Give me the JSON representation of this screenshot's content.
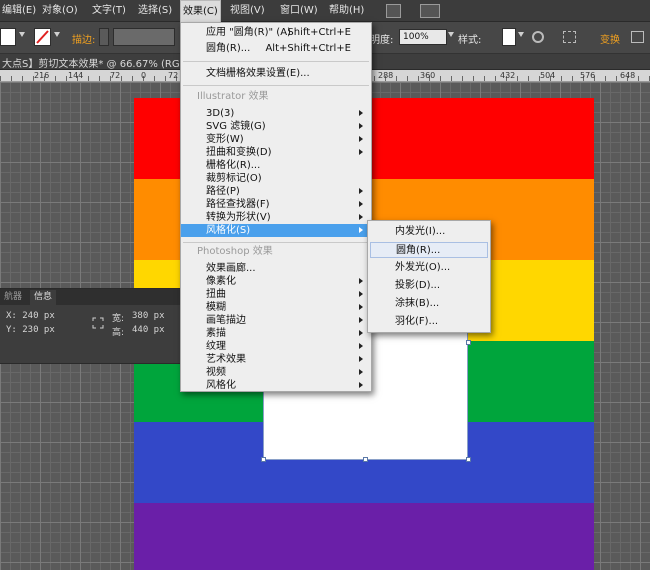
{
  "menubar": {
    "items": [
      {
        "label": "编辑(E)"
      },
      {
        "label": "对象(O)"
      },
      {
        "label": "文字(T)"
      },
      {
        "label": "选择(S)"
      },
      {
        "label": "效果(C)"
      },
      {
        "label": "视图(V)"
      },
      {
        "label": "窗口(W)"
      },
      {
        "label": "帮助(H)"
      }
    ],
    "active_index": 4
  },
  "control_bar": {
    "stroke_label": "描边:",
    "opacity_label": "明度:",
    "opacity_value": "100%",
    "style_label": "样式:",
    "transform_label": "变换",
    "accent_color": "#f0a020"
  },
  "document_tab": {
    "title": "大点S】剪切文本效果* @ 66.67% (RGB"
  },
  "ruler": {
    "labels": [
      "216",
      "144",
      "72",
      "0",
      "72",
      "144",
      "216",
      "288",
      "360",
      "432",
      "504",
      "576",
      "648"
    ]
  },
  "artboard": {
    "stripe_colors": [
      "#ff0000",
      "#ff8c00",
      "#ffd700",
      "#00a53c",
      "#3348c8",
      "#6a1fa8"
    ]
  },
  "info_panel": {
    "tabs": [
      "航器",
      "信息"
    ],
    "active_tab": 1,
    "x": "X: 240 px",
    "y": "Y: 230 px",
    "w_label": "宽:",
    "w_value": "380 px",
    "h_label": "高:",
    "h_value": "440 px"
  },
  "effect_menu": {
    "apply_last": {
      "label": "应用 \"圆角(R)\" (A)",
      "shortcut": "Shift+Ctrl+E"
    },
    "last_effect": {
      "label": "圆角(R)...",
      "shortcut": "Alt+Shift+Ctrl+E"
    },
    "raster_settings": "文档栅格效果设置(E)...",
    "illustrator_section": "Illustrator 效果",
    "illustrator_items": [
      {
        "label": "3D(3)",
        "sub": true
      },
      {
        "label": "SVG 滤镜(G)",
        "sub": true
      },
      {
        "label": "变形(W)",
        "sub": true
      },
      {
        "label": "扭曲和变换(D)",
        "sub": true
      },
      {
        "label": "栅格化(R)...",
        "sub": false
      },
      {
        "label": "裁剪标记(O)",
        "sub": false
      },
      {
        "label": "路径(P)",
        "sub": true
      },
      {
        "label": "路径查找器(F)",
        "sub": true
      },
      {
        "label": "转换为形状(V)",
        "sub": true
      },
      {
        "label": "风格化(S)",
        "sub": true
      }
    ],
    "highlighted_index": 9,
    "photoshop_section": "Photoshop 效果",
    "photoshop_items": [
      {
        "label": "效果画廊...",
        "sub": false
      },
      {
        "label": "像素化",
        "sub": true
      },
      {
        "label": "扭曲",
        "sub": true
      },
      {
        "label": "模糊",
        "sub": true
      },
      {
        "label": "画笔描边",
        "sub": true
      },
      {
        "label": "素描",
        "sub": true
      },
      {
        "label": "纹理",
        "sub": true
      },
      {
        "label": "艺术效果",
        "sub": true
      },
      {
        "label": "视频",
        "sub": true
      },
      {
        "label": "风格化",
        "sub": true
      }
    ]
  },
  "stylize_submenu": {
    "items": [
      {
        "label": "内发光(I)..."
      },
      {
        "label": "圆角(R)..."
      },
      {
        "label": "外发光(O)..."
      },
      {
        "label": "投影(D)..."
      },
      {
        "label": "涂抹(B)..."
      },
      {
        "label": "羽化(F)..."
      }
    ],
    "hovered_index": 1
  }
}
